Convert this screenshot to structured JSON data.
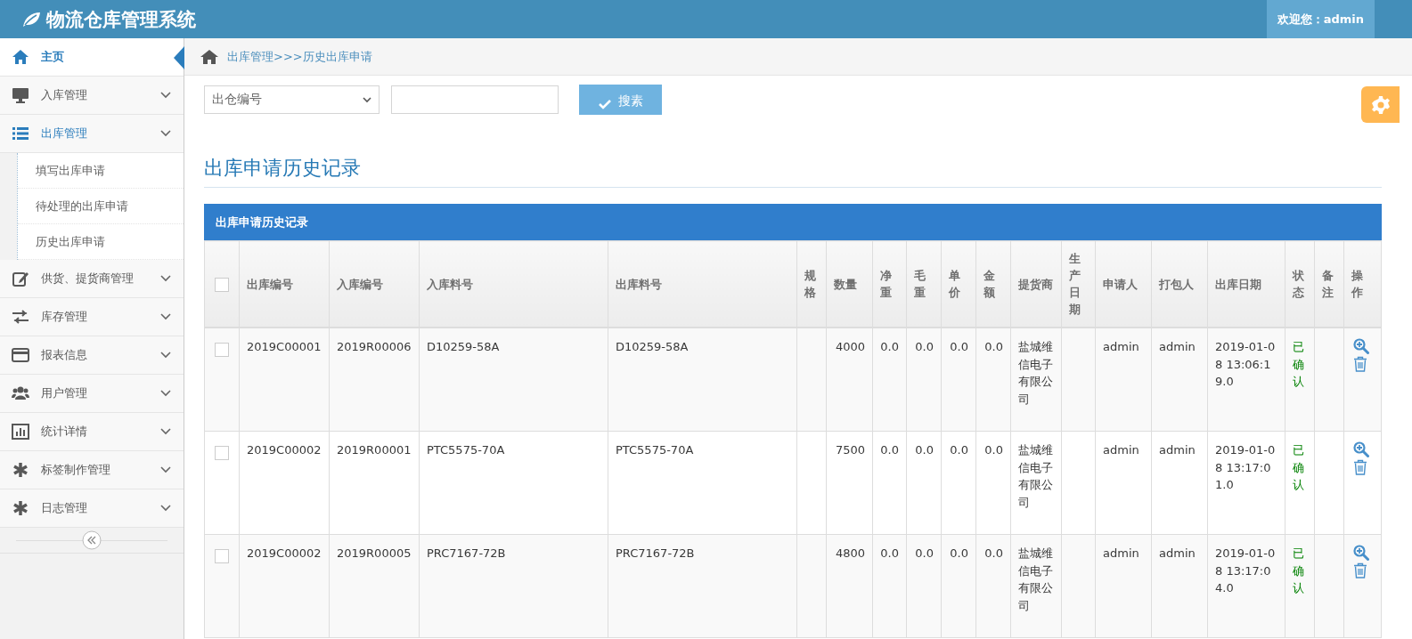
{
  "header": {
    "title": "物流仓库管理系统",
    "welcome": "欢迎您：admin"
  },
  "sidebar": {
    "items": [
      {
        "label": "主页",
        "selected": true,
        "expanded": false
      },
      {
        "label": "入库管理",
        "selected": false,
        "expanded": false
      },
      {
        "label": "出库管理",
        "selected": false,
        "expanded": true,
        "children": [
          {
            "label": "填写出库申请",
            "selected": false
          },
          {
            "label": "待处理的出库申请",
            "selected": false
          },
          {
            "label": "历史出库申请",
            "selected": false
          }
        ]
      },
      {
        "label": "供货、提货商管理",
        "selected": false,
        "expanded": false
      },
      {
        "label": "库存管理",
        "selected": false,
        "expanded": false
      },
      {
        "label": "报表信息",
        "selected": false,
        "expanded": false
      },
      {
        "label": "用户管理",
        "selected": false,
        "expanded": false
      },
      {
        "label": "统计详情",
        "selected": false,
        "expanded": false
      },
      {
        "label": "标签制作管理",
        "selected": false,
        "expanded": false
      },
      {
        "label": "日志管理",
        "selected": false,
        "expanded": false
      }
    ]
  },
  "breadcrumb": "出库管理>>>历史出库申请",
  "search": {
    "select_value": "出仓编号",
    "button": "搜素"
  },
  "page_title": "出库申请历史记录",
  "table": {
    "caption": "出库申请历史记录",
    "header_checked": false,
    "columns": [
      "出库编号",
      "入库编号",
      "入库料号",
      "出库料号",
      "规格",
      "数量",
      "净重",
      "毛重",
      "单价",
      "金额",
      "提货商",
      "生产日期",
      "申请人",
      "打包人",
      "出库日期",
      "状态",
      "备注",
      "操作"
    ],
    "rows": [
      {
        "checked": false,
        "cells": [
          "2019C00001",
          "2019R00006",
          "D10259-58A",
          "D10259-58A",
          null,
          "4000",
          "0.0",
          "0.0",
          "0.0",
          "0.0",
          "盐城维信电子有限公司",
          null,
          "admin",
          "admin",
          "2019-01-08 13:06:19.0",
          "已确认",
          null
        ]
      },
      {
        "checked": false,
        "cells": [
          "2019C00002",
          "2019R00001",
          "PTC5575-70A",
          "PTC5575-70A",
          null,
          "7500",
          "0.0",
          "0.0",
          "0.0",
          "0.0",
          "盐城维信电子有限公司",
          null,
          "admin",
          "admin",
          "2019-01-08 13:17:01.0",
          "已确认",
          null
        ]
      },
      {
        "checked": false,
        "cells": [
          "2019C00002",
          "2019R00005",
          "PRC7167-72B",
          "PRC7167-72B",
          null,
          "4800",
          "0.0",
          "0.0",
          "0.0",
          "0.0",
          "盐城维信电子有限公司",
          null,
          "admin",
          "admin",
          "2019-01-08 13:17:04.0",
          "已确认",
          null
        ]
      }
    ]
  }
}
